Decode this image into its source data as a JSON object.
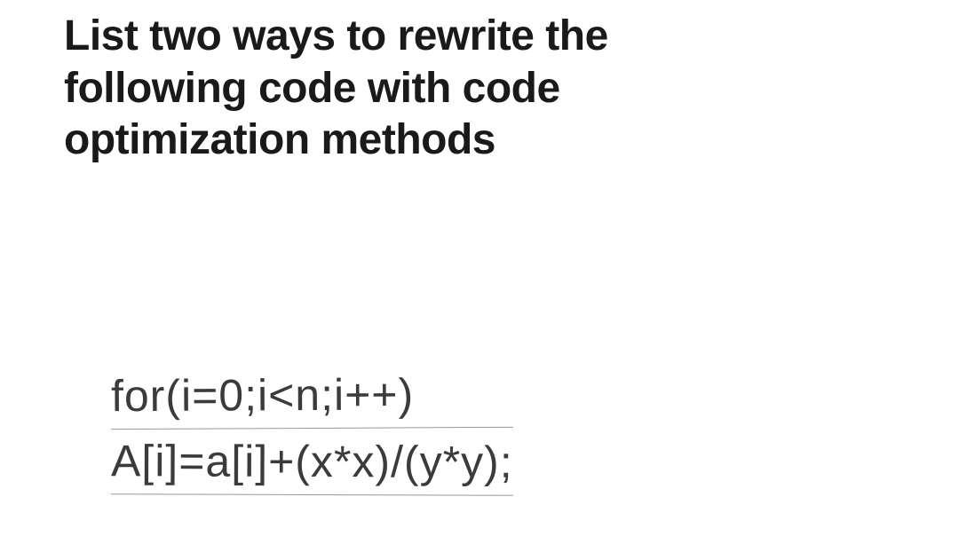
{
  "question": {
    "line1": "List two ways to rewrite the",
    "line2": "following code with code",
    "line3": "optimization methods"
  },
  "code": {
    "line1": "for(i=0;i<n;i++)",
    "line2": "A[i]=a[i]+(x*x)/(y*y);"
  }
}
